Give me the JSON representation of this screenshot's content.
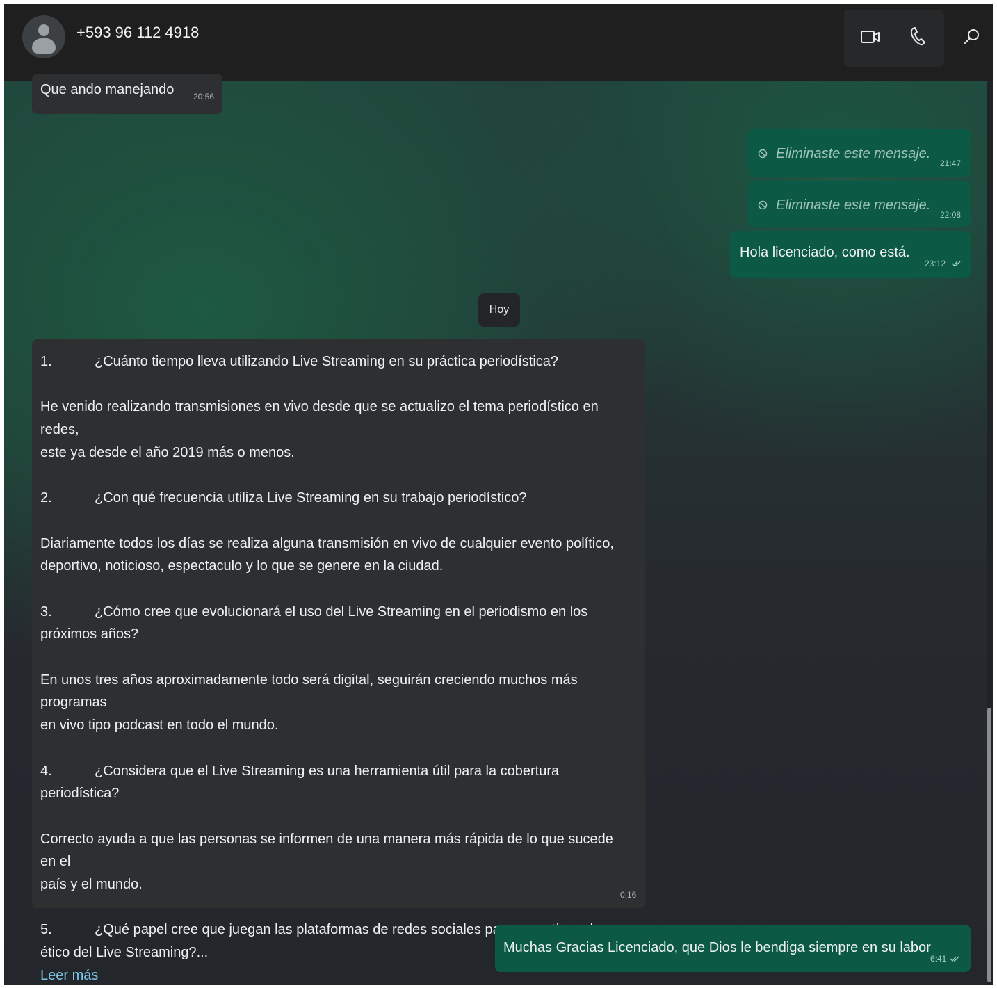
{
  "header": {
    "contact": "+593 96 112 4918",
    "icons": [
      "video-call-icon",
      "voice-call-icon",
      "search-icon"
    ]
  },
  "messages": {
    "m1": {
      "text": "Que ando manejando",
      "time": "20:56"
    },
    "m2": {
      "text": "Eliminaste este mensaje.",
      "time": "21:47"
    },
    "m3": {
      "text": "Eliminaste este mensaje.",
      "time": "22:08"
    },
    "m4": {
      "text": "Hola licenciado, como está.",
      "time": "23:12"
    },
    "date_divider": "Hoy",
    "long": {
      "q1_num": "1.",
      "q1": "¿Cuánto tiempo lleva utilizando Live Streaming en su práctica periodística?",
      "a1_l1": "He venido realizando transmisiones en vivo desde que se actualizo el tema periodístico en redes,",
      "a1_l2": "este ya desde el año 2019 más o menos.",
      "q2_num": "2.",
      "q2": "¿Con qué frecuencia utiliza Live Streaming en su trabajo periodístico?",
      "a2_l1": "Diariamente todos los días se realiza alguna transmisión en vivo de cualquier evento político,",
      "a2_l2": "deportivo, noticioso, espectaculo y lo que se genere en la ciudad.",
      "q3_num": "3.",
      "q3": "¿Cómo cree que evolucionará el uso del Live Streaming en el periodismo en los",
      "q3_l2": "próximos años?",
      "a3_l1": "En unos tres años aproximadamente todo será digital, seguirán creciendo muchos más programas",
      "a3_l2": "en vivo tipo podcast en todo el mundo.",
      "q4_num": "4.",
      "q4": "¿Considera que el Live Streaming es una herramienta útil para la cobertura periodística?",
      "a4_l1": "Correcto ayuda a que las personas se informen de una manera más rápida de lo que sucede en el",
      "a4_l2": "país y el mundo.",
      "q5_num": "5.",
      "q5": "¿Qué papel cree que juegan las plataformas de redes sociales para garantizar el uso",
      "q5_l2": "ético del Live Streaming?...",
      "read_more": "Leer más",
      "time": "0:16"
    },
    "m6": {
      "text": "Muchas Gracias Licenciado, que Dios le bendiga siempre en su labor",
      "time": "6:41"
    }
  },
  "colors": {
    "incoming_bubble": "#2e2f30",
    "outgoing_bubble": "#0c5a45",
    "header": "#1f1f1f",
    "link": "#7cc7e6"
  }
}
